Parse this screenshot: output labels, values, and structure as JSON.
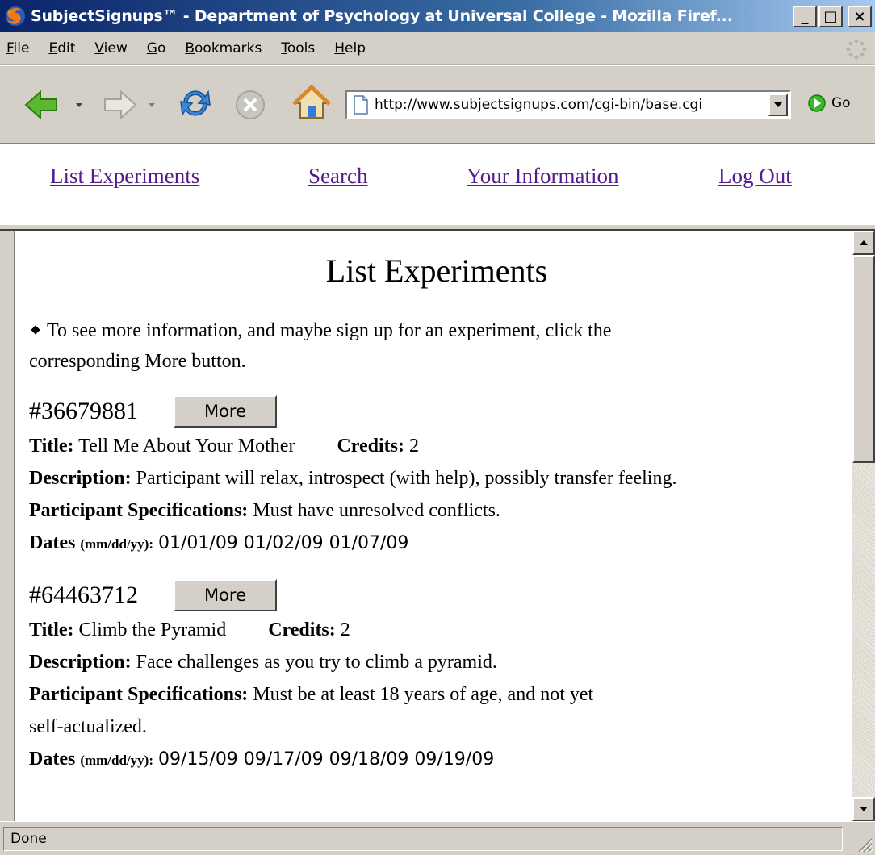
{
  "window": {
    "title": "SubjectSignups™ - Department of Psychology at Universal College - Mozilla Firef...",
    "minimize": "_",
    "maximize": "□",
    "close": "×"
  },
  "menu": [
    {
      "label": "File",
      "key": "F",
      "rest": "ile"
    },
    {
      "label": "Edit",
      "key": "E",
      "rest": "dit"
    },
    {
      "label": "View",
      "key": "V",
      "rest": "iew"
    },
    {
      "label": "Go",
      "key": "G",
      "rest": "o"
    },
    {
      "label": "Bookmarks",
      "key": "B",
      "rest": "ookmarks"
    },
    {
      "label": "Tools",
      "key": "T",
      "rest": "ools"
    },
    {
      "label": "Help",
      "key": "H",
      "rest": "elp"
    }
  ],
  "toolbar": {
    "url": "http://www.subjectsignups.com/cgi-bin/base.cgi",
    "go_label": "Go"
  },
  "nav_links": {
    "list": "List Experiments",
    "search": "Search",
    "info": "Your Information",
    "logout": "Log Out"
  },
  "page": {
    "title": "List Experiments",
    "intro_line1": "To see more information, and maybe sign up for an experiment, click the",
    "intro_line2": "corresponding More button.",
    "labels": {
      "title": "Title:",
      "credits": "Credits:",
      "description": "Description:",
      "specs": "Participant Specifications:",
      "dates": "Dates",
      "dates_format": "(mm/dd/yy):"
    },
    "more_label": "More",
    "experiments": [
      {
        "id": "#36679881",
        "title": "Tell Me About Your Mother",
        "credits": "2",
        "description": "Participant will relax, introspect (with help), possibly transfer feeling.",
        "specs_line1": "Must have unresolved conflicts.",
        "specs_line2": "",
        "dates": "01/01/09 01/02/09 01/07/09"
      },
      {
        "id": "#64463712",
        "title": "Climb the Pyramid",
        "credits": "2",
        "description": "Face challenges as you try to climb a pyramid.",
        "specs_line1": "Must be at least 18 years of age, and not yet",
        "specs_line2": "self-actualized.",
        "dates": "09/15/09 09/17/09 09/18/09 09/19/09"
      }
    ]
  },
  "status": {
    "text": "Done"
  },
  "icons": {
    "app": "firefox-icon",
    "back": "back-arrow-icon",
    "forward": "forward-arrow-icon",
    "reload": "reload-icon",
    "stop": "stop-icon",
    "home": "home-icon",
    "page": "page-icon",
    "go": "go-icon"
  }
}
